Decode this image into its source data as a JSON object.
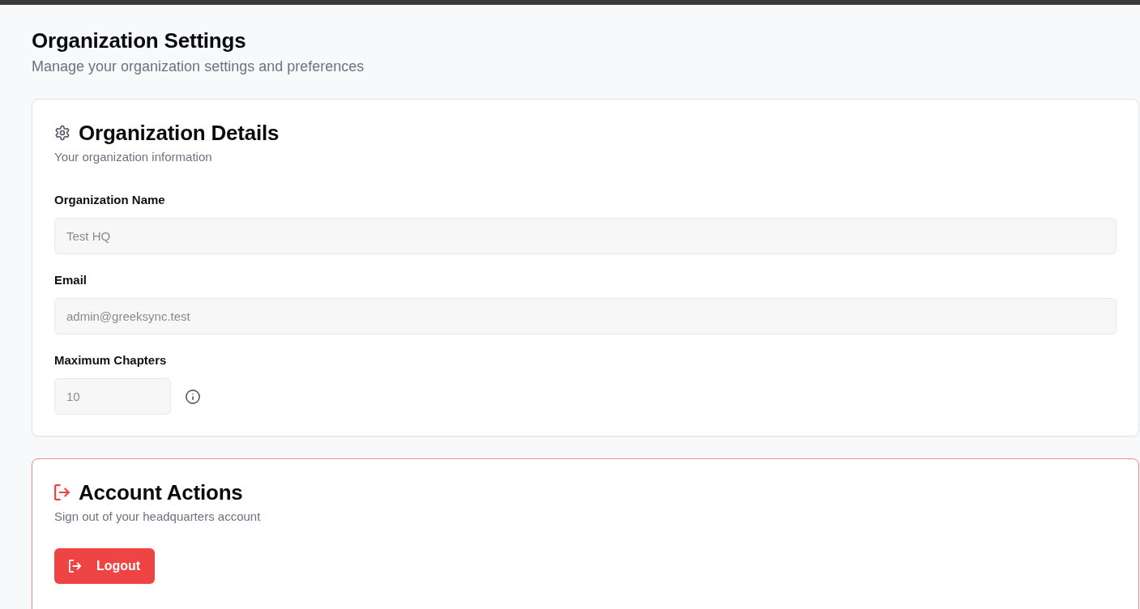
{
  "page": {
    "title": "Organization Settings",
    "subtitle": "Manage your organization settings and preferences"
  },
  "cards": [
    {
      "kind": "details",
      "title": "Organization Details",
      "description": "Your organization information",
      "fields": [
        {
          "kind": "text",
          "label": "Organization Name",
          "value": "Test HQ",
          "disabled": true
        },
        {
          "kind": "text",
          "label": "Email",
          "value": "admin@greeksync.test",
          "disabled": true
        },
        {
          "kind": "number",
          "label": "Maximum Chapters",
          "value": "10",
          "disabled": true
        }
      ]
    },
    {
      "kind": "danger",
      "title": "Account Actions",
      "description": "Sign out of your headquarters account",
      "button": {
        "label": "Logout"
      }
    }
  ]
}
